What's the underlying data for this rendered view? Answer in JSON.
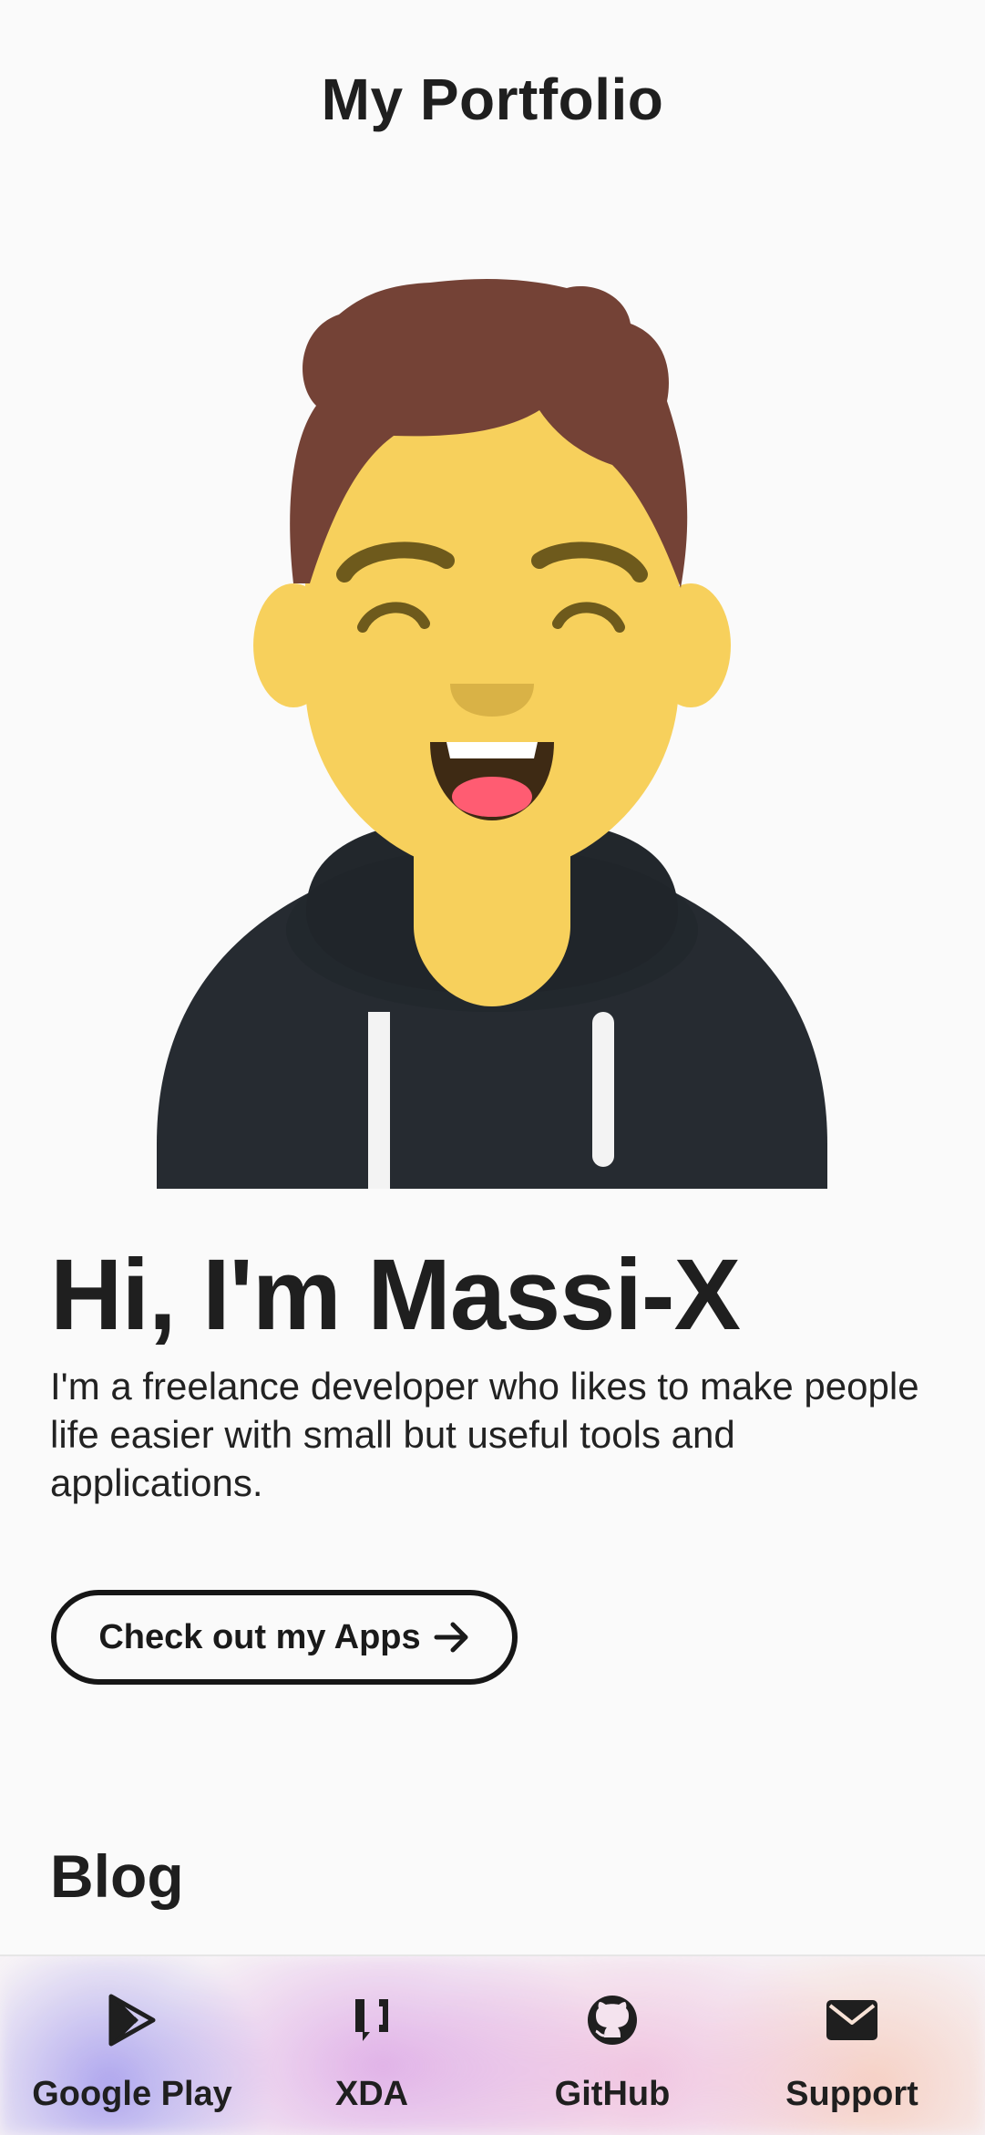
{
  "header": {
    "title": "My Portfolio"
  },
  "hero": {
    "greeting": "Hi, I'm Massi-X",
    "description": "I'm a freelance developer who likes to make people life easier with small but useful tools and applications.",
    "cta_label": "Check out my Apps",
    "avatar_icon": "smiling-developer-avatar"
  },
  "blog": {
    "title": "Blog"
  },
  "bottom_nav": {
    "items": [
      {
        "label": "Google Play",
        "icon": "google-play-icon"
      },
      {
        "label": "XDA",
        "icon": "xda-icon"
      },
      {
        "label": "GitHub",
        "icon": "github-icon"
      },
      {
        "label": "Support",
        "icon": "envelope-icon"
      }
    ]
  },
  "colors": {
    "background": "#fafafa",
    "text": "#1f1f1f",
    "skin": "#f7d05c",
    "hair": "#744236",
    "hoodie": "#262b31"
  }
}
